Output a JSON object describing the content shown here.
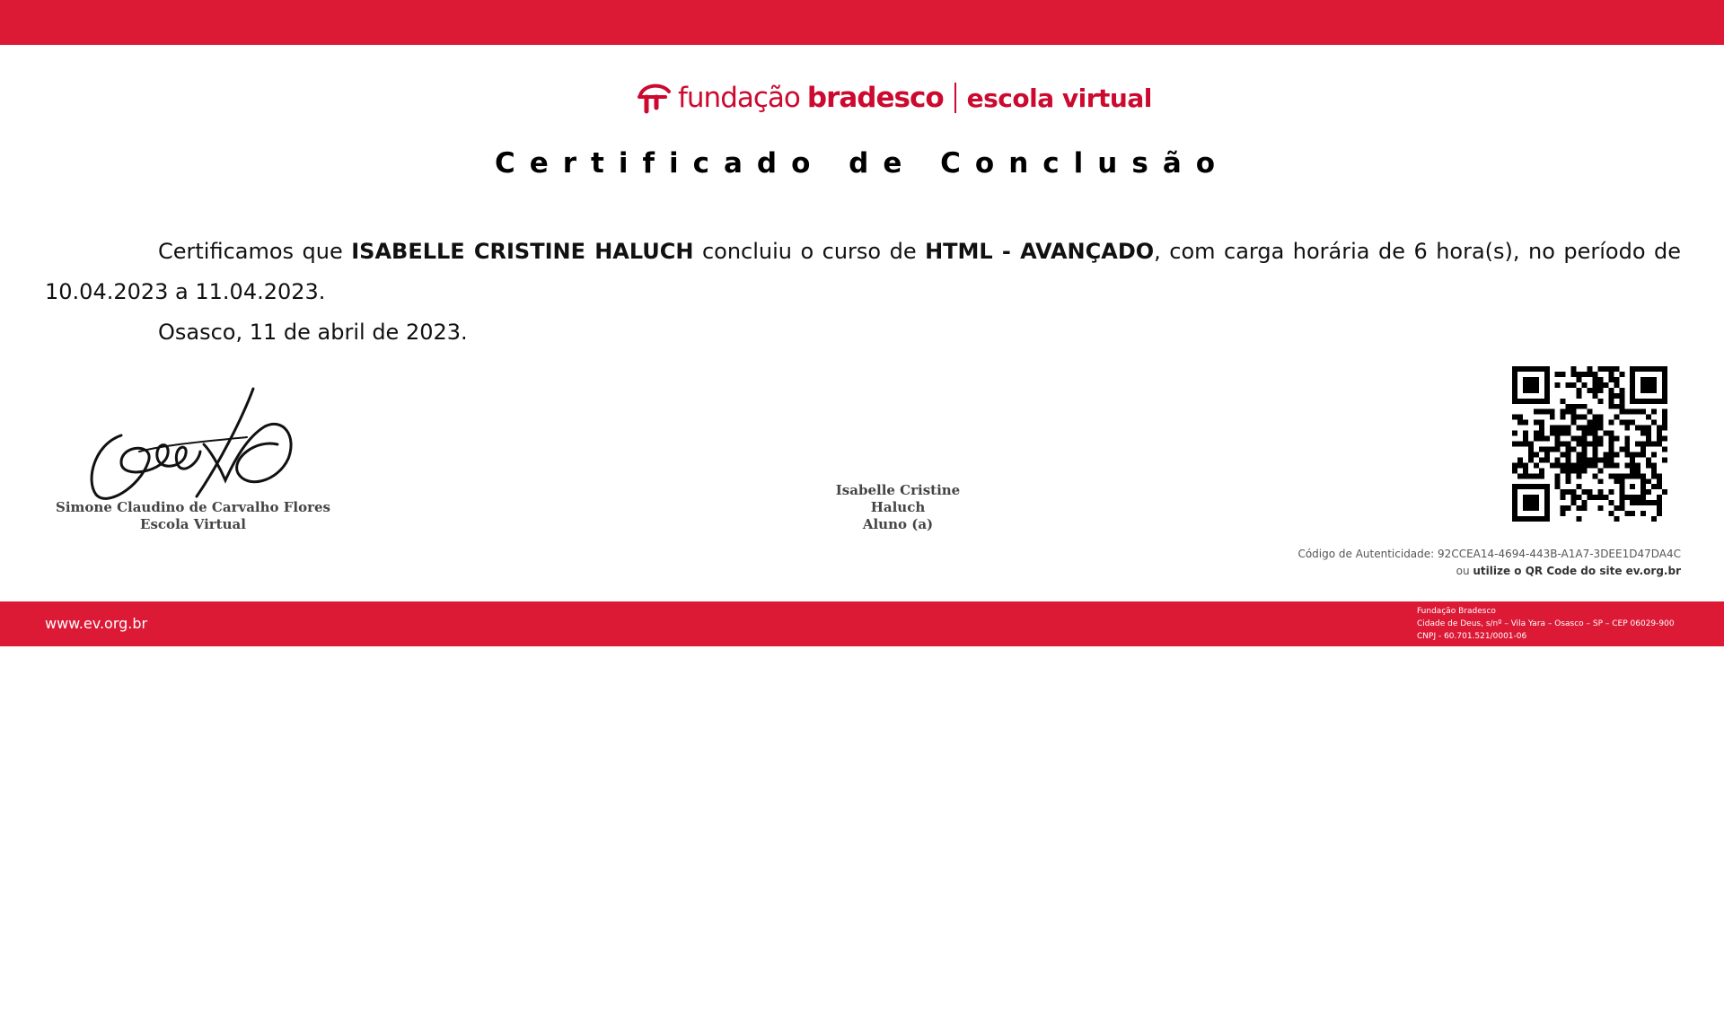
{
  "logo": {
    "fundacao": "fundação",
    "bradesco": "bradesco",
    "escola": "escola virtual",
    "brand_color": "#cc092f"
  },
  "title": "Certificado de Conclusão",
  "body": {
    "p1_a": "Certificamos que ",
    "student_name": "ISABELLE CRISTINE HALUCH",
    "p1_b": " concluiu o curso de ",
    "course": "HTML - AVANÇADO",
    "p1_c": ", com carga horária de 6 hora(s), no período de 10.04.2023 a 11.04.2023.",
    "p2": "Osasco, 11 de abril de 2023."
  },
  "signatures": {
    "left_name": "Simone Claudino de Carvalho Flores",
    "left_role": "Escola Virtual",
    "mid_line1": "Isabelle Cristine",
    "mid_line2": "Haluch",
    "mid_role": "Aluno (a)"
  },
  "auth": {
    "label": "Código de Autenticidade:",
    "code": "92CCEA14-4694-443B-A1A7-3DEE1D47DA4C",
    "hint_a": "ou ",
    "hint_b": "utilize o QR Code do site  ev.org.br"
  },
  "footer": {
    "site": "www.ev.org.br",
    "addr1": "Fundação Bradesco",
    "addr2": "Cidade de Deus, s/nº – Vila Yara – Osasco – SP – CEP 06029-900",
    "addr3": "CNPJ - 60.701.521/0001-06"
  },
  "colors": {
    "band": "#dc1a36"
  }
}
